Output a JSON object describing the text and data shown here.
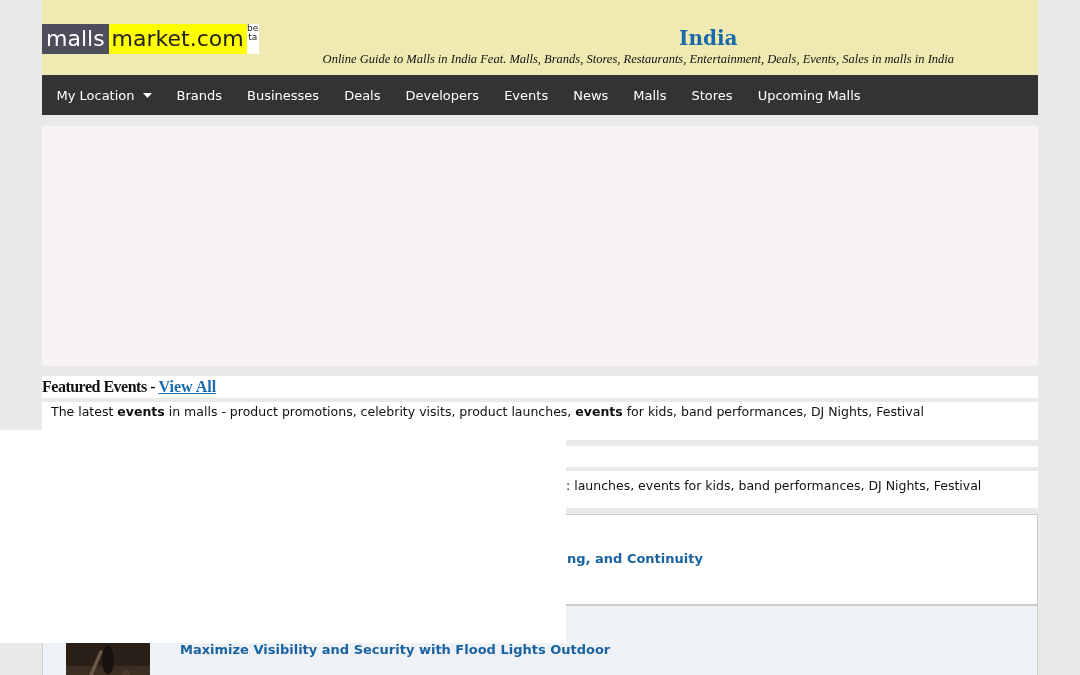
{
  "header": {
    "logo": {
      "part_1": "malls",
      "part_2": "market.com",
      "badge": "beta"
    },
    "title": "India",
    "tagline": "Online Guide to Malls in India Feat. Malls, Brands, Stores, Restaurants, Entertainment, Deals, Events, Sales in malls in India"
  },
  "nav": [
    {
      "label": "My Location",
      "kind": "dropdown"
    },
    {
      "label": "Brands",
      "kind": "link"
    },
    {
      "label": "Businesses",
      "kind": "link"
    },
    {
      "label": "Deals",
      "kind": "link"
    },
    {
      "label": "Developers",
      "kind": "link"
    },
    {
      "label": "Events",
      "kind": "link"
    },
    {
      "label": "News",
      "kind": "link"
    },
    {
      "label": "Malls",
      "kind": "link"
    },
    {
      "label": "Stores",
      "kind": "link"
    },
    {
      "label": "Upcoming Malls",
      "kind": "link"
    }
  ],
  "featured": {
    "heading": "Featured Events - ",
    "link": "View All",
    "intro": "The latest **events** in malls - product promotions, celebrity visits, product launches, **events** for kids, band performances, DJ Nights, Festival"
  },
  "second_intro": ": launches, events for kids, band performances, DJ Nights, Festival",
  "articles": [
    {
      "title": "ng, and Continuity",
      "kind": "text"
    },
    {
      "title": "Maximize Visibility and Security with Flood Lights Outdoor",
      "kind": "picture"
    }
  ]
}
